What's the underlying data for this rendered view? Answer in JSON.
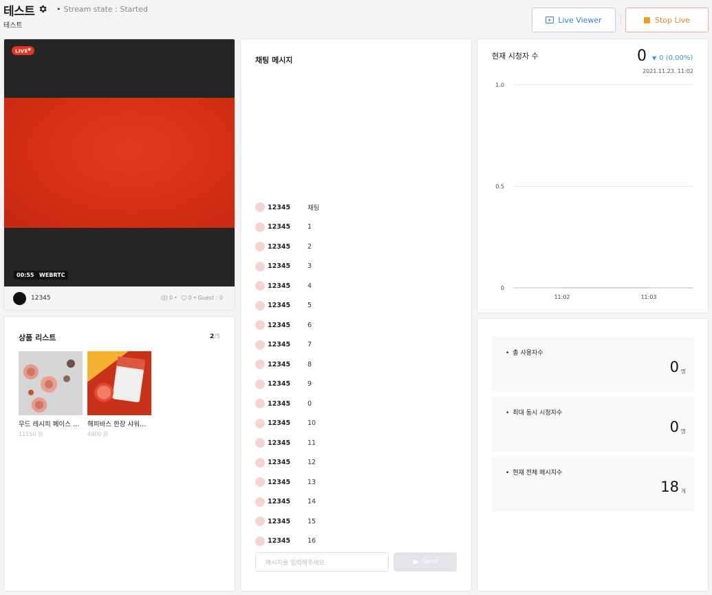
{
  "header": {
    "title": "테스트",
    "stream_state": "Stream state : Started",
    "subtitle": "테스트",
    "live_viewer_label": "Live Viewer",
    "stop_live_label": "Stop Live"
  },
  "video": {
    "live_badge": "LIVE",
    "timer": "00:55",
    "protocol": "WEBRTC",
    "host_name": "12345",
    "views": "0",
    "likes": "0",
    "guest": "Guest : 0"
  },
  "products": {
    "title": "상품 리스트",
    "count_current": "2",
    "count_total": "/5",
    "items": [
      {
        "name": "무드 레시피 페이스 롤러",
        "price": "11150 원"
      },
      {
        "name": "해피바스 한장 샤워티슈",
        "price": "4900 원"
      }
    ]
  },
  "chat": {
    "title": "채팅 메시지",
    "messages": [
      {
        "user": "12345",
        "text": "채팅"
      },
      {
        "user": "12345",
        "text": "1"
      },
      {
        "user": "12345",
        "text": "2"
      },
      {
        "user": "12345",
        "text": "3"
      },
      {
        "user": "12345",
        "text": "4"
      },
      {
        "user": "12345",
        "text": "5"
      },
      {
        "user": "12345",
        "text": "6"
      },
      {
        "user": "12345",
        "text": "7"
      },
      {
        "user": "12345",
        "text": "8"
      },
      {
        "user": "12345",
        "text": "9"
      },
      {
        "user": "12345",
        "text": "0"
      },
      {
        "user": "12345",
        "text": "10"
      },
      {
        "user": "12345",
        "text": "11"
      },
      {
        "user": "12345",
        "text": "12"
      },
      {
        "user": "12345",
        "text": "13"
      },
      {
        "user": "12345",
        "text": "14"
      },
      {
        "user": "12345",
        "text": "15"
      },
      {
        "user": "12345",
        "text": "16"
      }
    ],
    "input_placeholder": "메시지를 입력해주세요.",
    "send_label": "Send"
  },
  "viewers": {
    "title": "현재 시청자 수",
    "count": "0",
    "delta": "0 (0.00%)",
    "timestamp": "2021.11.23. 11:02"
  },
  "chart_data": {
    "type": "line",
    "x": [
      "11:02",
      "11:03"
    ],
    "series": [
      {
        "values": [
          0,
          0
        ]
      }
    ],
    "yticks": [
      "1.0",
      "0.5",
      "0"
    ],
    "ylim": [
      0,
      1
    ],
    "grid": true
  },
  "stats": [
    {
      "label": "총 사용자수",
      "value": "0",
      "unit": "명"
    },
    {
      "label": "최대 동시 시청자수",
      "value": "0",
      "unit": "명"
    },
    {
      "label": "현재 전체 메시지수",
      "value": "18",
      "unit": "개"
    }
  ],
  "colors": {
    "accent_blue": "#2d7fd6",
    "stop_orange": "#f39a1e",
    "live_red": "#e33322",
    "video_red": "#d62f14"
  }
}
